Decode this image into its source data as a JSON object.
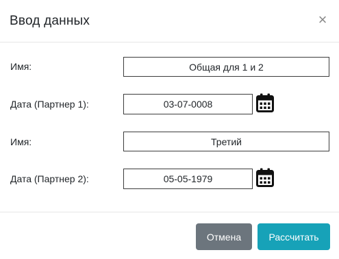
{
  "dialog": {
    "title": "Ввод данных",
    "close_symbol": "×"
  },
  "fields": [
    {
      "label": "Имя:",
      "value": "Общая для 1 и 2"
    },
    {
      "label": "Дата (Партнер 1):",
      "value": "03-07-0008",
      "icon": "calendar-icon"
    },
    {
      "label": "Имя:",
      "value": "Третий"
    },
    {
      "label": "Дата (Партнер 2):",
      "value": "05-05-1979",
      "icon": "calendar-icon"
    }
  ],
  "footer": {
    "cancel_label": "Отмена",
    "calculate_label": "Рассчитать"
  },
  "colors": {
    "cancel_button": "#6c757d",
    "calculate_button": "#17a2b8",
    "field_border": "#3c3c3c",
    "divider": "#e6e6e6"
  }
}
